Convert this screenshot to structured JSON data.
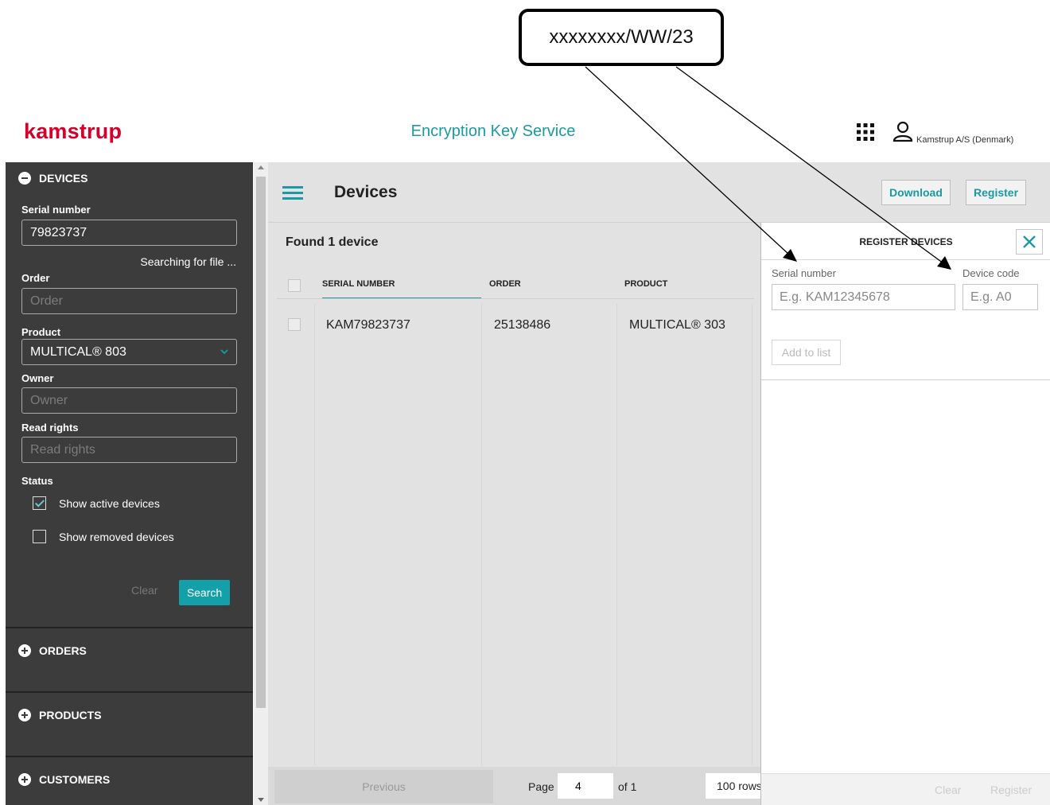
{
  "annotation": {
    "text": "xxxxxxxx/WW/23"
  },
  "header": {
    "logo": "kamstrup",
    "app_title": "Encryption Key Service",
    "company": "Kamstrup A/S (Denmark)"
  },
  "sidebar": {
    "devices_title": "DEVICES",
    "serial_label": "Serial number",
    "serial_value": "79823737",
    "searching_text": "Searching for file ...",
    "order_label": "Order",
    "order_placeholder": "Order",
    "product_label": "Product",
    "product_value": "MULTICAL® 803",
    "owner_label": "Owner",
    "owner_placeholder": "Owner",
    "read_rights_label": "Read rights",
    "read_rights_placeholder": "Read rights",
    "status_label": "Status",
    "show_active": "Show active devices",
    "show_removed": "Show removed devices",
    "clear": "Clear",
    "search": "Search",
    "orders_title": "ORDERS",
    "products_title": "PRODUCTS",
    "customers_title": "CUSTOMERS"
  },
  "main": {
    "title": "Devices",
    "download": "Download",
    "register": "Register",
    "found": "Found 1 device",
    "columns": {
      "serial": "SERIAL NUMBER",
      "order": "ORDER",
      "product": "PRODUCT"
    },
    "rows": [
      {
        "serial": "KAM79823737",
        "order": "25138486",
        "product": "MULTICAL® 303"
      }
    ],
    "footer": {
      "previous": "Previous",
      "page_label": "Page",
      "page_value": "4",
      "of_label": "of 1",
      "rows": "100 rows"
    }
  },
  "panel": {
    "title": "REGISTER DEVICES",
    "serial_label": "Serial number",
    "serial_placeholder": "E.g. KAM12345678",
    "code_label": "Device code",
    "code_placeholder": "E.g. A0",
    "add_to_list": "Add to list",
    "clear": "Clear",
    "register": "Register"
  },
  "colors": {
    "brand_red": "#d4002a",
    "teal": "#1b9aa3",
    "sidebar_bg": "#3c3c3c"
  }
}
